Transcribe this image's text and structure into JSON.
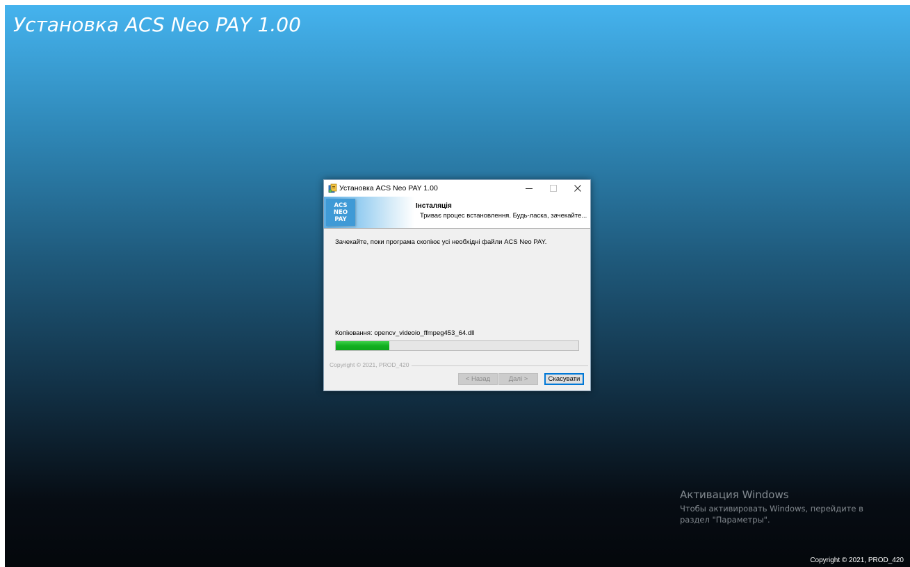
{
  "background": {
    "title": "Установка ACS Neo PAY 1.00",
    "copyright": "Copyright © 2021, PROD_420",
    "activation": {
      "title": "Активация Windows",
      "description": "Чтобы активировать Windows, перейдите в раздел \"Параметры\"."
    }
  },
  "dialog": {
    "window_title": "Установка ACS Neo PAY 1.00",
    "controls": {
      "minimize": "—",
      "maximize": "☐",
      "close": "✕"
    },
    "icons": {
      "app": "installer-icon"
    },
    "header": {
      "logo_line1": "ACS NEO",
      "logo_line2": "PAY",
      "title": "Інсталяція",
      "subtitle": "Триває процес встановлення. Будь-ласка, зачекайте..."
    },
    "body_text": "Зачекайте, поки програма скопіює усі необхідні файли ACS Neo PAY.",
    "copy_status": "Копіювання: opencv_videoio_ffmpeg453_64.dll",
    "progress_fraction": 0.22,
    "footer_copyright": "Copyright © 2021, PROD_420",
    "buttons": {
      "back": "< Назад",
      "next": "Далі >",
      "cancel": "Скасувати"
    }
  },
  "colors": {
    "progress": "#12b021",
    "accent_border": "#0078d7",
    "background_top": "#45b3ee",
    "background_bottom": "#04070b"
  }
}
